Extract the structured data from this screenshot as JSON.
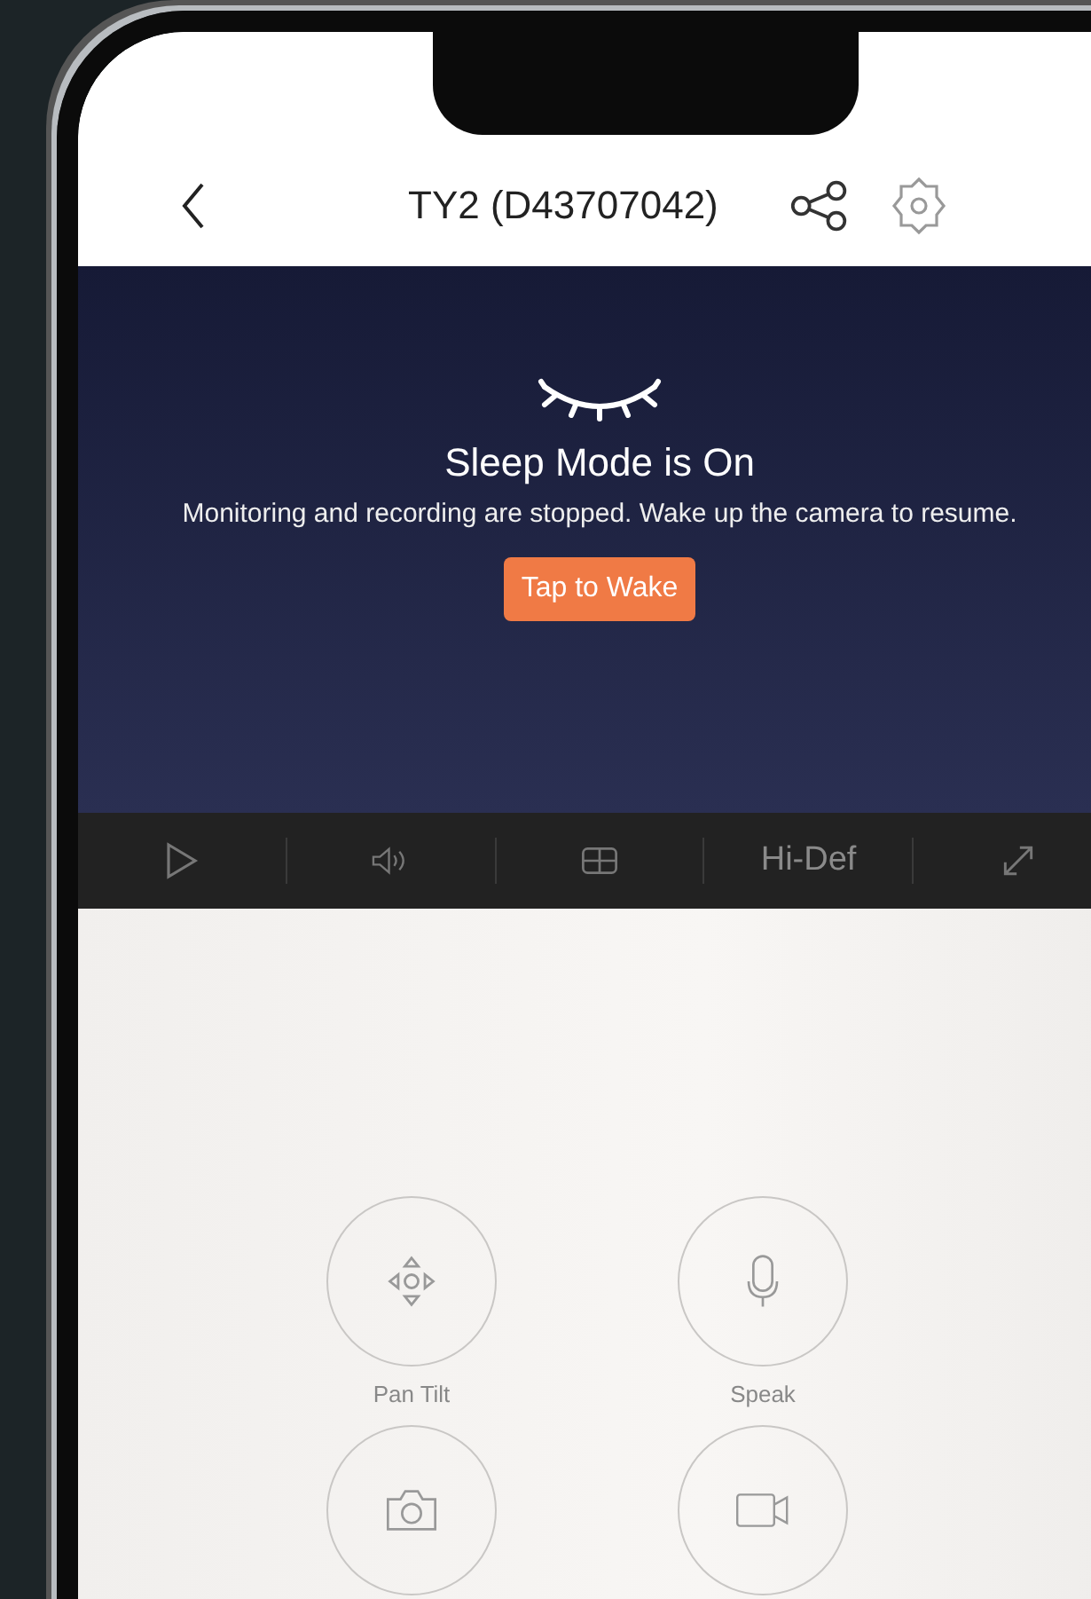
{
  "header": {
    "title": "TY2 (D43707042)"
  },
  "sleep": {
    "title": "Sleep Mode is On",
    "message": "Monitoring and recording are stopped. Wake up the camera to resume.",
    "wake_button": "Tap to Wake"
  },
  "toolbar": [
    {
      "kind": "play"
    },
    {
      "kind": "volume"
    },
    {
      "kind": "layout"
    },
    {
      "kind": "text",
      "label": "Hi-Def"
    },
    {
      "kind": "fullscreen"
    }
  ],
  "controls": [
    {
      "kind": "pan-tilt",
      "label": "Pan Tilt"
    },
    {
      "kind": "mic",
      "label": "Speak"
    },
    {
      "kind": "camera"
    },
    {
      "kind": "video"
    }
  ]
}
